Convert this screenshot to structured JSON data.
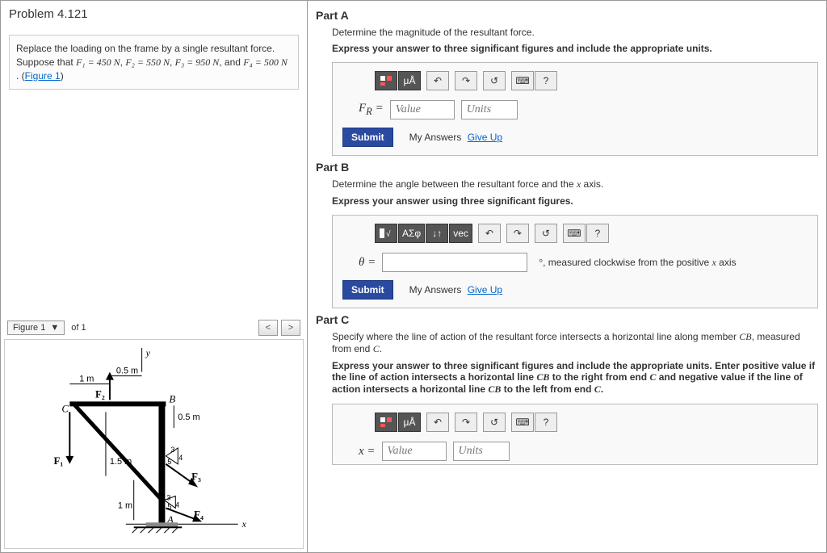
{
  "problem": {
    "title": "Problem 4.121",
    "text_pre": "Replace the loading on the frame by a single resultant force. Suppose that ",
    "F1": "F₁ = 450 N",
    "comma1": ", ",
    "F2": "F₂ = 550 N",
    "comma2": ", ",
    "F3": "F₃ = 950 N",
    "and": ", and ",
    "F4": "F₄ = 500 N",
    "period": " . (",
    "fig_link": "Figure 1",
    "close": ")"
  },
  "figurebar": {
    "label": "Figure 1",
    "of": "of 1"
  },
  "partA": {
    "head": "Part A",
    "sub": "Determine the magnitude of the resultant force.",
    "instr": "Express your answer to three significant figures and include the appropriate units.",
    "eq": "F",
    "eq_sub": "R",
    "eq_post": " = ",
    "val_ph": "Value",
    "unit_ph": "Units",
    "submit": "Submit",
    "my": "My Answers",
    "give": "Give Up",
    "tb_ua": "μÅ"
  },
  "partB": {
    "head": "Part B",
    "sub_pre": "Determine the angle between the resultant force and the ",
    "sub_x": "x",
    "sub_post": " axis.",
    "instr": "Express your answer using three significant figures.",
    "eq": "θ = ",
    "suffix_deg": "°",
    "suffix_text": ", measured clockwise from the positive ",
    "suffix_x": "x",
    "suffix_axis": " axis",
    "submit": "Submit",
    "my": "My Answers",
    "give": "Give Up",
    "tb_asf": "ΑΣφ",
    "tb_vec": "vec"
  },
  "partC": {
    "head": "Part C",
    "sub_pre": "Specify where the line of action of the resultant force intersects a horizontal line along member ",
    "sub_cb": "CB",
    "sub_mid": ", measured from end ",
    "sub_c": "C",
    "sub_post": ".",
    "instr_pre": "Express your answer to three significant figures and include the appropriate units. Enter positive value if the line of action intersects a horizontal line ",
    "instr_cb1": "CB",
    "instr_mid1": " to the right from end ",
    "instr_c1": "C",
    "instr_mid2": " and negative value if the line of action intersects a horizontal line ",
    "instr_cb2": "CB",
    "instr_mid3": " to the left from end ",
    "instr_c2": "C",
    "instr_post": ".",
    "eq": "x = ",
    "val_ph": "Value",
    "unit_ph": "Units",
    "tb_ua": "μÅ"
  },
  "figure": {
    "y": "y",
    "x": "x",
    "m1": "1 m",
    "m05a": "0.5 m",
    "m05b": "0.5 m",
    "m15": "1.5 m",
    "m1b": "1 m",
    "C": "C",
    "B": "B",
    "A": "A",
    "F1": "F₁",
    "F2": "F₂",
    "F3": "F₃",
    "F4": "F₄",
    "a3": "3",
    "a4": "4",
    "a5": "5",
    "b3": "3",
    "b4": "4",
    "b5": "5"
  }
}
